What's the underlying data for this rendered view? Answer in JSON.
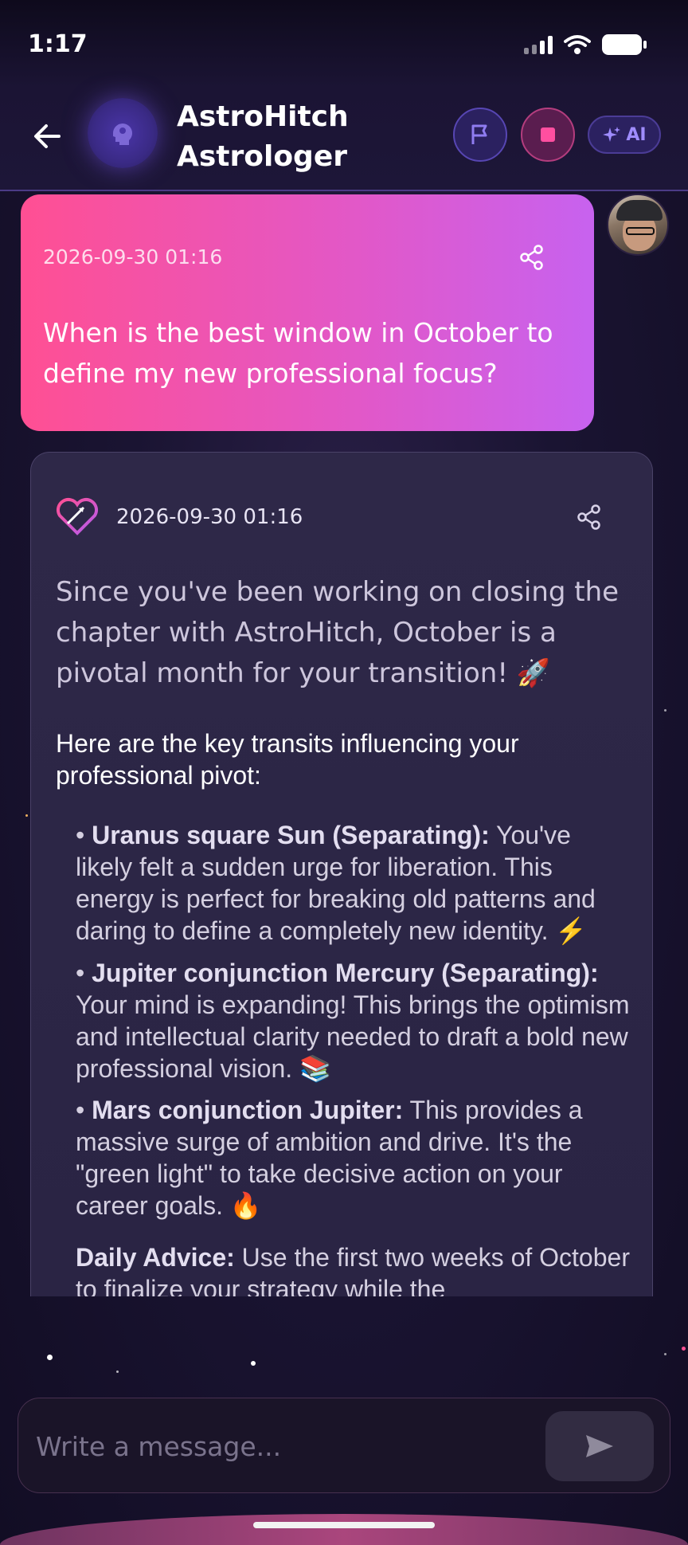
{
  "status_bar": {
    "time": "1:17"
  },
  "header": {
    "back_icon": "arrow-left-icon",
    "title": "AstroHitch Astrologer",
    "flag_icon": "flag-icon",
    "stop_icon": "stop-icon",
    "ai_label": "AI"
  },
  "messages": [
    {
      "role": "user",
      "timestamp": "2026-09-30 01:16",
      "text": "When is the best window in October to define my new professional focus?"
    },
    {
      "role": "assistant",
      "timestamp": "2026-09-30 01:16",
      "intro": "Since you've been working on closing the chapter with AstroHitch, October is a pivotal month for your transition! 🚀",
      "subheading": "Here are the key transits influencing your professional pivot:",
      "items": [
        {
          "title": "Uranus square Sun (Separating):",
          "body": " You've likely felt a sudden urge for liberation. This energy is perfect for breaking old patterns and daring to define a completely new identity. ⚡"
        },
        {
          "title": "Jupiter conjunction Mercury (Separating):",
          "body": " Your mind is expanding! This brings the optimism and intellectual clarity needed to draft a bold new professional vision. 📚"
        },
        {
          "title": "Mars conjunction Jupiter:",
          "body": " This provides a massive surge of ambition and drive. It's the \"green light\" to take decisive action on your career goals. 🔥"
        }
      ],
      "advice_title": "Daily Advice:",
      "advice_body": " Use the first two weeks of October to finalize your strategy while the"
    }
  ],
  "composer": {
    "placeholder": "Write a message..."
  },
  "colors": {
    "accent": "#c762ef",
    "user_bubble_start": "#ff4f93",
    "stop_red": "#ff4fa0"
  }
}
